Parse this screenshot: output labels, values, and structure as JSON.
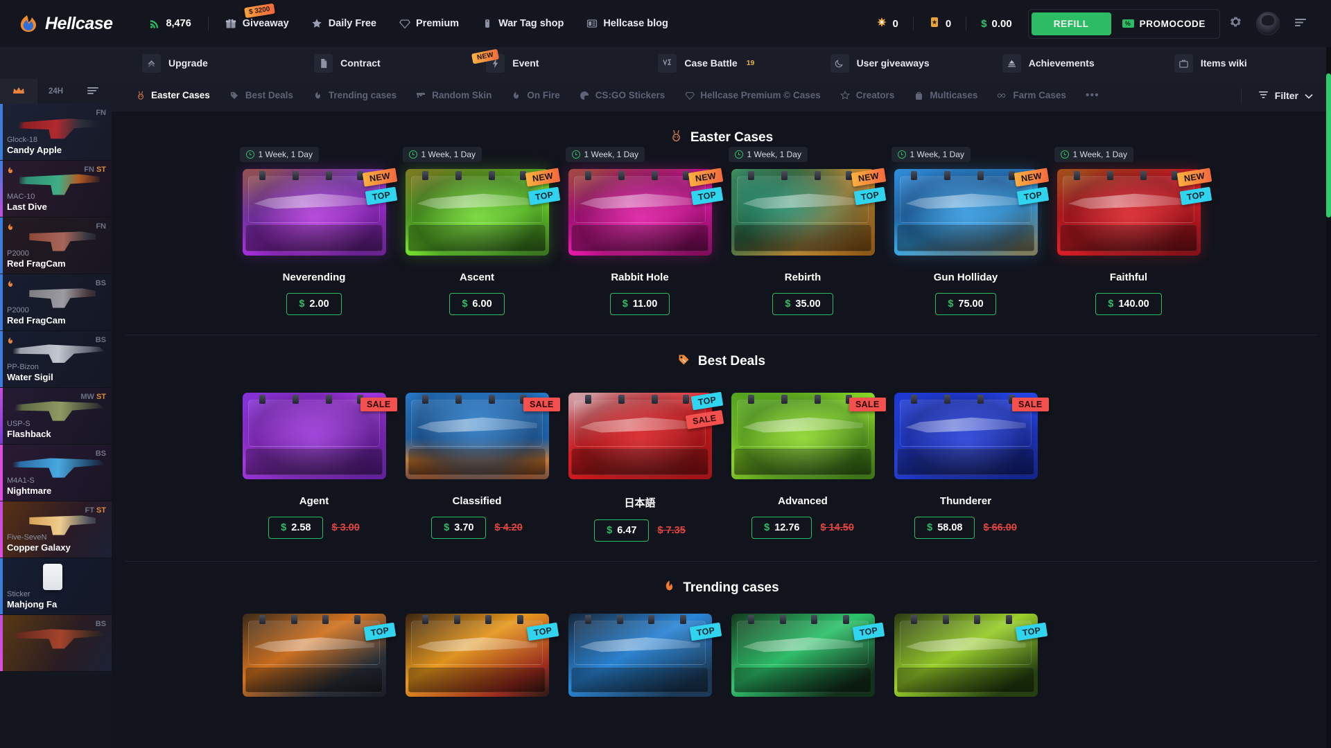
{
  "brand": {
    "name": "Hellcase",
    "logo_icon": "hellcase-flame-logo"
  },
  "header": {
    "online_icon": "signal-icon",
    "online_count": "8,476",
    "nav": [
      {
        "id": "giveaway",
        "label": "Giveaway",
        "icon": "gift-icon",
        "badge": "$ 3200"
      },
      {
        "id": "dailyfree",
        "label": "Daily Free",
        "icon": "star-icon"
      },
      {
        "id": "premium",
        "label": "Premium",
        "icon": "diamond-icon"
      },
      {
        "id": "wartag",
        "label": "War Tag shop",
        "icon": "dogtag-icon"
      },
      {
        "id": "blog",
        "label": "Hellcase blog",
        "icon": "news-icon"
      }
    ],
    "balances": [
      {
        "id": "gem",
        "icon": "gem-icon",
        "value": "0"
      },
      {
        "id": "coin",
        "icon": "coin-icon",
        "value": "0"
      },
      {
        "id": "money",
        "icon": "dollar-icon",
        "value": "0.00",
        "symbol": "$"
      }
    ],
    "refill_label": "REFILL",
    "promocode_label": "PROMOCODE",
    "promocode_icon": "percent-ticket-icon",
    "settings_icon": "gear-icon",
    "menu_icon": "hamburger-icon",
    "avatar_icon": "user-avatar",
    "accent_green": "#2cbc63"
  },
  "subnav": [
    {
      "id": "upgrade",
      "label": "Upgrade",
      "icon": "chevron-up-icon"
    },
    {
      "id": "contract",
      "label": "Contract",
      "icon": "document-icon"
    },
    {
      "id": "event",
      "label": "Event",
      "icon": "lightning-icon",
      "badge": "NEW"
    },
    {
      "id": "casebattle",
      "label": "Case Battle",
      "icon": "versus-icon",
      "count": "19"
    },
    {
      "id": "usergiveaways",
      "label": "User giveaways",
      "icon": "moon-icon"
    },
    {
      "id": "achievements",
      "label": "Achievements",
      "icon": "trophy-icon"
    },
    {
      "id": "itemswiki",
      "label": "Items wiki",
      "icon": "briefcase-icon"
    }
  ],
  "sidebar": {
    "tabs": [
      {
        "id": "live",
        "label": "",
        "icon": "crown-icon",
        "active": true
      },
      {
        "id": "24h",
        "label": "24H",
        "icon": "",
        "active": false
      },
      {
        "id": "menu",
        "label": "",
        "icon": "lines-icon",
        "active": false
      }
    ],
    "drops": [
      {
        "weapon": "Glock-18",
        "skin": "Candy Apple",
        "wear": "FN",
        "stattrak": "",
        "rail": "#3b7ddd",
        "fav": false
      },
      {
        "weapon": "MAC-10",
        "skin": "Last Dive",
        "wear": "FN",
        "stattrak": "ST",
        "rail": "#c44ce0",
        "fav": true
      },
      {
        "weapon": "P2000",
        "skin": "Red FragCam",
        "wear": "FN",
        "stattrak": "",
        "rail": "#3b7ddd",
        "fav": true
      },
      {
        "weapon": "P2000",
        "skin": "Red FragCam",
        "wear": "BS",
        "stattrak": "",
        "rail": "#3b7ddd",
        "fav": true
      },
      {
        "weapon": "PP-Bizon",
        "skin": "Water Sigil",
        "wear": "BS",
        "stattrak": "",
        "rail": "#3b7ddd",
        "fav": true
      },
      {
        "weapon": "USP-S",
        "skin": "Flashback",
        "wear": "MW",
        "stattrak": "ST",
        "rail": "#c44ce0",
        "fav": false
      },
      {
        "weapon": "M4A1-S",
        "skin": "Nightmare",
        "wear": "BS",
        "stattrak": "",
        "rail": "#e04ce0",
        "fav": false
      },
      {
        "weapon": "Five-SeveN",
        "skin": "Copper Galaxy",
        "wear": "FT",
        "stattrak": "ST",
        "rail": "#c44ce0",
        "fav": false
      },
      {
        "weapon": "Sticker",
        "skin": "Mahjong Fa",
        "wear": "",
        "stattrak": "",
        "rail": "#3b7ddd",
        "fav": false
      },
      {
        "weapon": "",
        "skin": "",
        "wear": "BS",
        "stattrak": "",
        "rail": "#c44ce0",
        "fav": false
      }
    ]
  },
  "categories": {
    "items": [
      {
        "id": "easter",
        "label": "Easter Cases",
        "icon": "rabbit-icon",
        "active": true
      },
      {
        "id": "bestdeals",
        "label": "Best Deals",
        "icon": "pricetag-icon",
        "active": false
      },
      {
        "id": "trending",
        "label": "Trending cases",
        "icon": "flame-icon",
        "active": false
      },
      {
        "id": "randomskin",
        "label": "Random Skin",
        "icon": "pistol-icon",
        "active": false
      },
      {
        "id": "onfire",
        "label": "On Fire",
        "icon": "flame-icon",
        "active": false
      },
      {
        "id": "stickers",
        "label": "CS:GO Stickers",
        "icon": "sticker-icon",
        "active": false
      },
      {
        "id": "premium",
        "label": "Hellcase Premium © Cases",
        "icon": "diamond-icon",
        "active": false
      },
      {
        "id": "creators",
        "label": "Creators",
        "icon": "star-icon",
        "active": false
      },
      {
        "id": "multicases",
        "label": "Multicases",
        "icon": "case-icon",
        "active": false
      },
      {
        "id": "farmcases",
        "label": "Farm Cases",
        "icon": "infinity-icon",
        "active": false
      }
    ],
    "more_icon": "ellipsis-icon",
    "filter_label": "Filter",
    "filter_icon": "filter-icon",
    "filter_chevron": "chevron-down-icon"
  },
  "sections": [
    {
      "id": "easter",
      "title": "Easter Cases",
      "icon": "rabbit-icon",
      "cases": [
        {
          "name": "Neverending",
          "price": "2.00",
          "old_price": "",
          "timer": "1 Week, 1 Day",
          "tags": [
            "NEW",
            "TOP"
          ],
          "art": "art-neverending"
        },
        {
          "name": "Ascent",
          "price": "6.00",
          "old_price": "",
          "timer": "1 Week, 1 Day",
          "tags": [
            "NEW",
            "TOP"
          ],
          "art": "art-ascent"
        },
        {
          "name": "Rabbit Hole",
          "price": "11.00",
          "old_price": "",
          "timer": "1 Week, 1 Day",
          "tags": [
            "NEW",
            "TOP"
          ],
          "art": "art-rabbit"
        },
        {
          "name": "Rebirth",
          "price": "35.00",
          "old_price": "",
          "timer": "1 Week, 1 Day",
          "tags": [
            "NEW",
            "TOP"
          ],
          "art": "art-rebirth"
        },
        {
          "name": "Gun Holliday",
          "price": "75.00",
          "old_price": "",
          "timer": "1 Week, 1 Day",
          "tags": [
            "NEW",
            "TOP"
          ],
          "art": "art-gun"
        },
        {
          "name": "Faithful",
          "price": "140.00",
          "old_price": "",
          "timer": "1 Week, 1 Day",
          "tags": [
            "NEW",
            "TOP"
          ],
          "art": "art-faithful"
        }
      ]
    },
    {
      "id": "bestdeals",
      "title": "Best Deals",
      "icon": "pricetag-icon",
      "cases": [
        {
          "name": "Agent",
          "price": "2.58",
          "old_price": "3.00",
          "timer": "",
          "tags": [
            "SALE"
          ],
          "art": "art-agent"
        },
        {
          "name": "Classified",
          "price": "3.70",
          "old_price": "4.20",
          "timer": "",
          "tags": [
            "SALE"
          ],
          "art": "art-classified"
        },
        {
          "name": "日本語",
          "price": "6.47",
          "old_price": "7.35",
          "timer": "",
          "tags": [
            "TOP",
            "SALE"
          ],
          "art": "art-jp"
        },
        {
          "name": "Advanced",
          "price": "12.76",
          "old_price": "14.50",
          "timer": "",
          "tags": [
            "SALE"
          ],
          "art": "art-advanced"
        },
        {
          "name": "Thunderer",
          "price": "58.08",
          "old_price": "66.00",
          "timer": "",
          "tags": [
            "SALE"
          ],
          "art": "art-thunderer"
        }
      ]
    }
  ],
  "trending": {
    "title": "Trending cases",
    "icon": "flame-icon",
    "cases": [
      {
        "name": "",
        "tags": [
          "TOP"
        ],
        "art": "art-t1"
      },
      {
        "name": "",
        "tags": [
          "TOP"
        ],
        "art": "art-t2"
      },
      {
        "name": "",
        "tags": [
          "TOP"
        ],
        "art": "art-t3"
      },
      {
        "name": "",
        "tags": [
          "TOP"
        ],
        "art": "art-t4"
      },
      {
        "name": "",
        "tags": [
          "TOP"
        ],
        "art": "art-t5"
      }
    ]
  },
  "currency_symbol": "$"
}
